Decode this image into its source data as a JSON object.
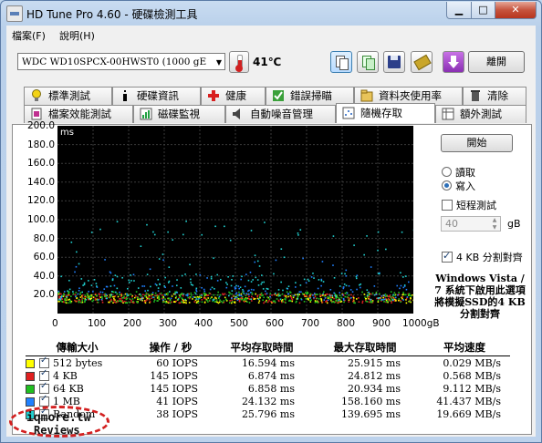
{
  "window": {
    "title": "HD Tune Pro 4.60 - 硬碟檢測工具",
    "minimize": "▁",
    "maximize": "□",
    "close": "✕"
  },
  "menu": [
    "檔案(F)",
    "說明(H)"
  ],
  "toolbar": {
    "drive": "WDC WD10SPCX-00HWST0    (1000 gE",
    "temperature": "41℃",
    "icons": [
      "copy-icon",
      "copy-alt-icon",
      "save-icon",
      "hardware-icon",
      "download-icon"
    ],
    "exit_label": "離開"
  },
  "tabs_row1": [
    {
      "label": "標準測試",
      "icon": "lightbulb-icon"
    },
    {
      "label": "硬碟資訊",
      "icon": "info-icon"
    },
    {
      "label": "健康",
      "icon": "health-cross-icon"
    },
    {
      "label": "錯誤掃瞄",
      "icon": "scan-icon"
    },
    {
      "label": "資料夾使用率",
      "icon": "folder-icon"
    },
    {
      "label": "清除",
      "icon": "trash-icon"
    }
  ],
  "tabs_row2": [
    {
      "label": "檔案效能測試",
      "icon": "file-bench-icon"
    },
    {
      "label": "磁碟監視",
      "icon": "monitor-icon"
    },
    {
      "label": "自動噪音管理",
      "icon": "speaker-icon"
    },
    {
      "label": "隨機存取",
      "icon": "random-access-icon"
    },
    {
      "label": "額外測試",
      "icon": "extra-test-icon"
    }
  ],
  "active_tab": "隨機存取",
  "colors": {
    "s512": "#ffff00",
    "s4k": "#e02020",
    "s64k": "#20c020",
    "s1m": "#2080ff",
    "random": "#20d0d0"
  },
  "chart_data": {
    "type": "scatter",
    "ylabel": "ms",
    "xlabel": "gB",
    "ylim": [
      0,
      200
    ],
    "xlim": [
      0,
      1000
    ],
    "yticks": [
      "200.0",
      "180.0",
      "160.0",
      "140.0",
      "120.0",
      "100.0",
      "80.0",
      "60.0",
      "40.0",
      "20.0"
    ],
    "xticks": [
      "0",
      "100",
      "200",
      "300",
      "400",
      "500",
      "600",
      "700",
      "800",
      "900",
      "1000gB"
    ],
    "grid": true,
    "series": [
      {
        "name": "512 bytes",
        "color": "#ffff00",
        "approx_range_ms": [
          12,
          22
        ]
      },
      {
        "name": "4 KB",
        "color": "#e02020",
        "approx_range_ms": [
          12,
          22
        ]
      },
      {
        "name": "64 KB",
        "color": "#20c020",
        "approx_range_ms": [
          12,
          24
        ]
      },
      {
        "name": "1 MB",
        "color": "#2080ff",
        "approx_range_ms": [
          15,
          60
        ]
      },
      {
        "name": "Random",
        "color": "#20d0d0",
        "approx_range_ms": [
          15,
          100
        ]
      }
    ]
  },
  "controls": {
    "start_label": "開始",
    "read_label": "讀取",
    "write_label": "寫入",
    "short_test_label": "短程測試",
    "short_test_value": "40",
    "unit": "gB",
    "align_label": "4 KB 分割對齊",
    "note": "Windows Vista / 7 系統下啟用此選項 將模擬SSD的4 KB 分割對齊"
  },
  "results": {
    "headers": [
      "傳輸大小",
      "操作 / 秒",
      "平均存取時間",
      "最大存取時間",
      "平均速度"
    ],
    "rows": [
      {
        "size": "512 bytes",
        "iops": "60 IOPS",
        "avg": "16.594 ms",
        "max": "25.915 ms",
        "speed": "0.029 MB/s",
        "color": "#ffff00"
      },
      {
        "size": "4 KB",
        "iops": "145 IOPS",
        "avg": "6.874 ms",
        "max": "24.812 ms",
        "speed": "0.568 MB/s",
        "color": "#e02020"
      },
      {
        "size": "64 KB",
        "iops": "145 IOPS",
        "avg": "6.858 ms",
        "max": "20.934 ms",
        "speed": "9.112 MB/s",
        "color": "#20c020"
      },
      {
        "size": "1 MB",
        "iops": "41 IOPS",
        "avg": "24.132 ms",
        "max": "158.160 ms",
        "speed": "41.437 MB/s",
        "color": "#2080ff"
      },
      {
        "size": "Random",
        "iops": "38 IOPS",
        "avg": "25.796 ms",
        "max": "139.695 ms",
        "speed": "19.669 MB/s",
        "color": "#20d0d0"
      }
    ]
  },
  "watermark": {
    "line1": "iqmore.tw",
    "line2": "Reviews"
  }
}
